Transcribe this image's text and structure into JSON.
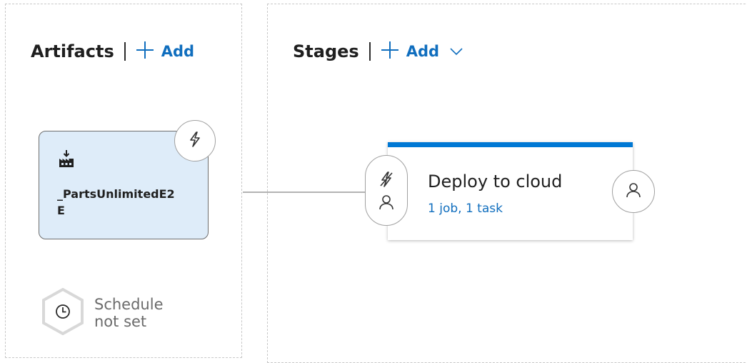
{
  "artifacts": {
    "title": "Artifacts",
    "add_label": "Add",
    "card": {
      "icon": "build-artifact-icon",
      "name_line1": "_PartsUnlimitedE2",
      "name_line2": "E"
    },
    "trigger_icon": "lightning-icon",
    "schedule": {
      "line1": "Schedule",
      "line2": "not set",
      "icon": "clock-icon"
    }
  },
  "stages": {
    "title": "Stages",
    "add_label": "Add",
    "stage": {
      "name": "Deploy to cloud",
      "summary": "1 job, 1 task",
      "accent": "#0078d4",
      "pre_deploy_icons": [
        "lightning-disabled-icon",
        "approver-icon"
      ],
      "post_deploy_icon": "approver-icon"
    }
  },
  "colors": {
    "link": "#106ebe",
    "artifact_card_bg": "#deecf9"
  }
}
